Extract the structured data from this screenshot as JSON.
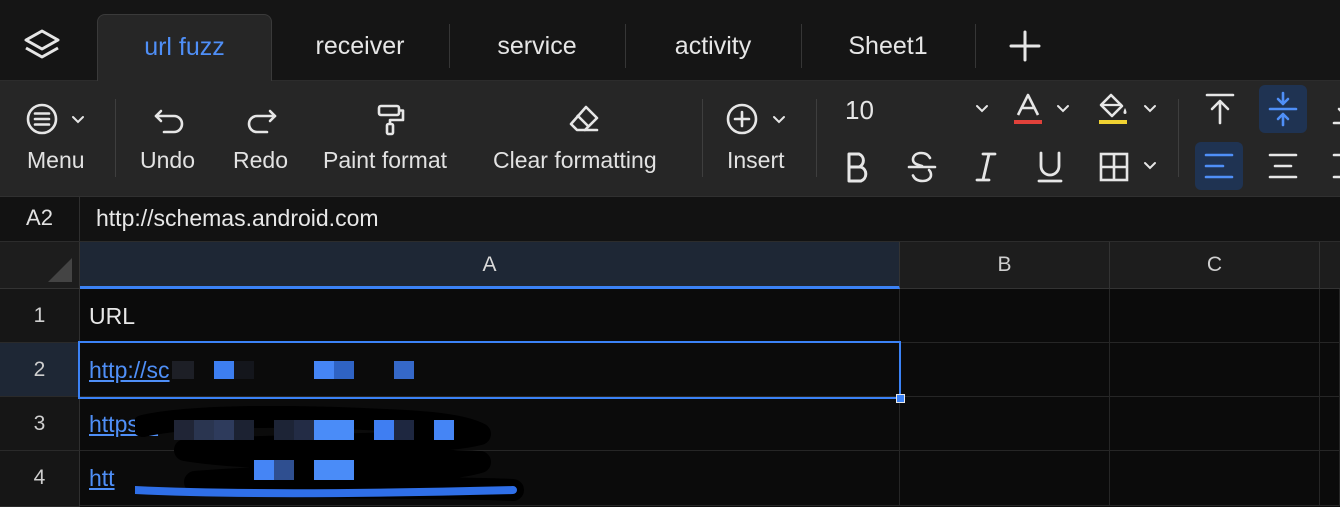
{
  "tabs": [
    {
      "label": "url fuzz",
      "active": true
    },
    {
      "label": "receiver",
      "active": false
    },
    {
      "label": "service",
      "active": false
    },
    {
      "label": "activity",
      "active": false
    },
    {
      "label": "Sheet1",
      "active": false
    }
  ],
  "toolbar": {
    "menu_label": "Menu",
    "undo_label": "Undo",
    "redo_label": "Redo",
    "paint_label": "Paint format",
    "clear_label": "Clear formatting",
    "insert_label": "Insert",
    "font_size": "10"
  },
  "colors": {
    "accent": "#3b82f6",
    "font_color_underline": "#e0413a",
    "fill_color_underline": "#f0d232"
  },
  "formula_bar": {
    "cell_ref": "A2",
    "value": "http://schemas.android.com"
  },
  "grid": {
    "columns": [
      "A",
      "B",
      "C"
    ],
    "rows": [
      {
        "num": "1",
        "a": "URL"
      },
      {
        "num": "2",
        "a": "http://sc"
      },
      {
        "num": "3",
        "a": "https://"
      },
      {
        "num": "4",
        "a": "htt"
      }
    ]
  }
}
